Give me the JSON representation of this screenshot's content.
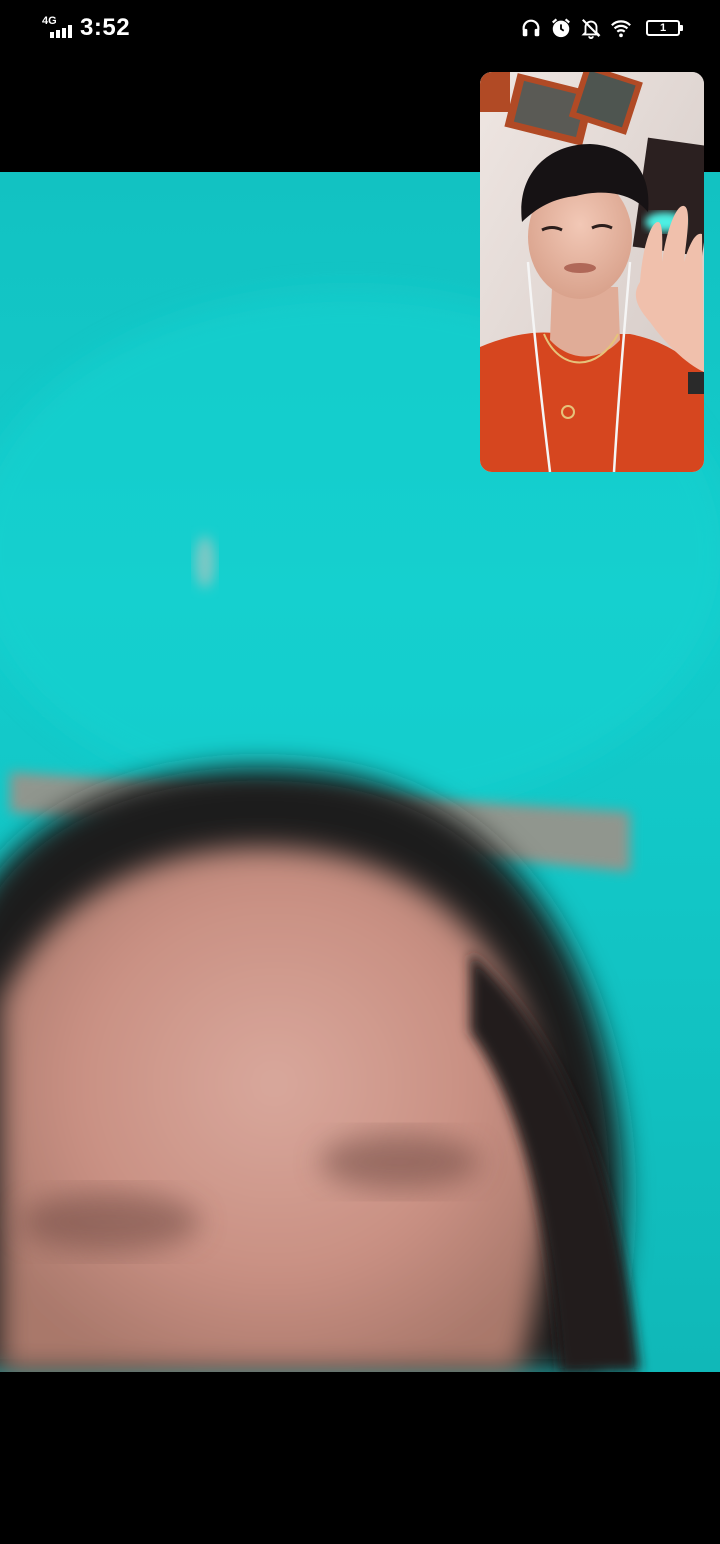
{
  "status_bar": {
    "network_type": "4G",
    "time": "3:52",
    "battery_level": "1",
    "icons": [
      "signal-icon",
      "headphones-icon",
      "alarm-icon",
      "notifications-off-icon",
      "wifi-icon",
      "battery-icon"
    ]
  },
  "call": {
    "remote_background_color": "#14cccc",
    "self_shirt_color": "#d6461f"
  }
}
